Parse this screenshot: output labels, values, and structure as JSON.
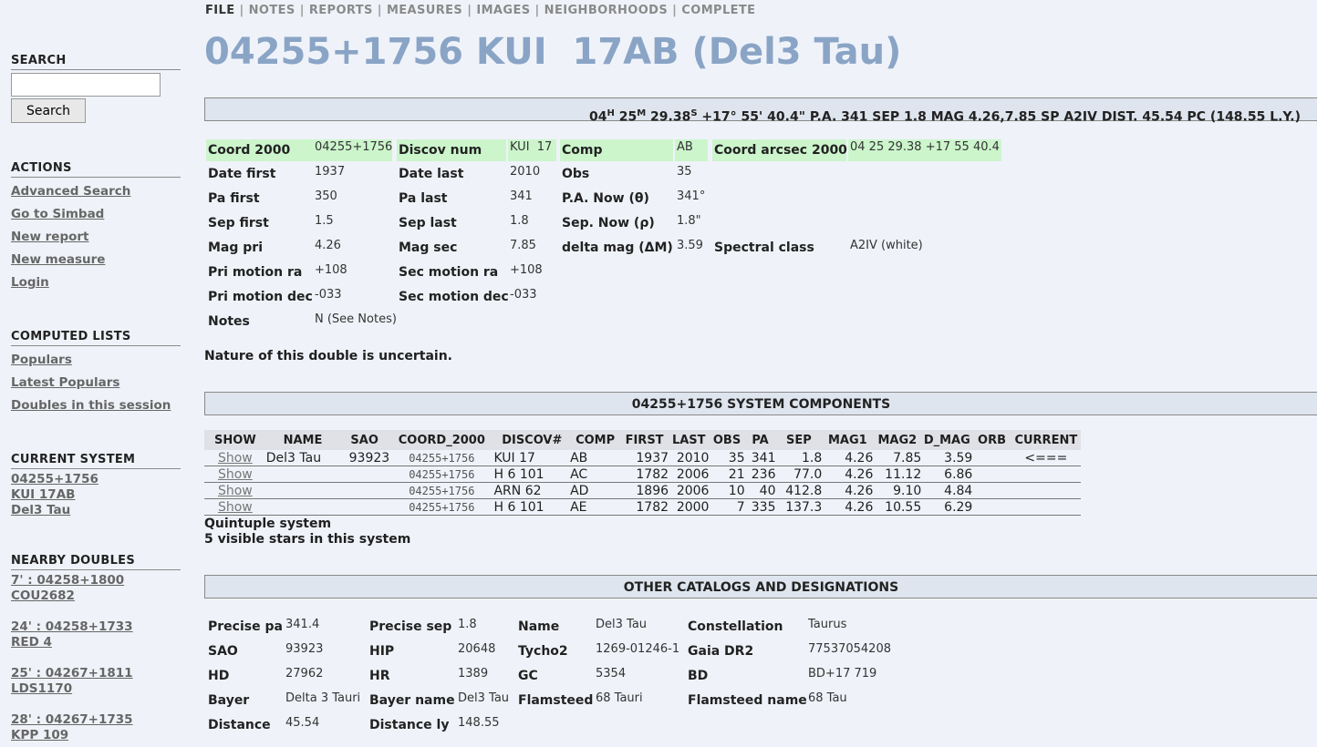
{
  "nav": {
    "items": [
      "FILE",
      "NOTES",
      "REPORTS",
      "MEASURES",
      "IMAGES",
      "NEIGHBORHOODS",
      "COMPLETE"
    ]
  },
  "title": "04255+1756 KUI  17AB (Del3 Tau)",
  "sidebar": {
    "search_heading": "SEARCH",
    "search_value": "",
    "search_button": "Search",
    "actions_heading": "ACTIONS",
    "actions": [
      "Advanced Search",
      "Go to Simbad",
      "New report",
      "New measure",
      "Login"
    ],
    "computed_heading": "COMPUTED LISTS",
    "computed": [
      "Populars",
      "Latest Populars",
      "Doubles in this session"
    ],
    "current_heading": "CURRENT SYSTEM",
    "current": [
      "04255+1756",
      "KUI 17AB",
      "Del3 Tau"
    ],
    "nearby_heading": "NEARBY DOUBLES",
    "nearby": [
      {
        "line1": "7' : 04258+1800",
        "line2": "COU2682"
      },
      {
        "line1": "24' : 04258+1733",
        "line2": "RED 4"
      },
      {
        "line1": "25' : 04267+1811",
        "line2": "LDS1170"
      },
      {
        "line1": "28' : 04267+1735",
        "line2": "KPP 109"
      }
    ]
  },
  "coord_bar": {
    "h": "04",
    "h_sup": "H",
    "m": "25",
    "m_sup": "M",
    "s": "29.38",
    "s_sup": "S",
    "rest": "+17° 55' 40.4\" P.A. 341 SEP 1.8 MAG 4.26,7.85 SP A2IV DIST. 45.54 PC (148.55 L.Y.)"
  },
  "details": {
    "coord2000_label": "Coord 2000",
    "coord2000": "04255+1756",
    "discov_label": "Discov num",
    "discov": "KUI  17",
    "comp_label": "Comp",
    "comp": "AB",
    "arcsec_label": "Coord arcsec 2000",
    "arcsec": "04 25 29.38 +17 55 40.4",
    "date_first_label": "Date first",
    "date_first": "1937",
    "date_last_label": "Date last",
    "date_last": "2010",
    "obs_label": "Obs",
    "obs": "35",
    "pa_first_label": "Pa first",
    "pa_first": "350",
    "pa_last_label": "Pa last",
    "pa_last": "341",
    "pa_now_label": "P.A. Now (θ)",
    "pa_now": "341°",
    "sep_first_label": "Sep first",
    "sep_first": "1.5",
    "sep_last_label": "Sep last",
    "sep_last": "1.8",
    "sep_now_label": "Sep. Now (ρ)",
    "sep_now": "1.8\"",
    "mag_pri_label": "Mag pri",
    "mag_pri": "4.26",
    "mag_sec_label": "Mag sec",
    "mag_sec": "7.85",
    "delta_mag_label": "delta mag (ΔM)",
    "delta_mag": "3.59",
    "spectral_label": "Spectral class",
    "spectral": "A2IV (white)",
    "pri_ra_label": "Pri motion ra",
    "pri_ra": "+108",
    "sec_ra_label": "Sec motion ra",
    "sec_ra": "+108",
    "pri_dec_label": "Pri motion dec",
    "pri_dec": "-033",
    "sec_dec_label": "Sec motion dec",
    "sec_dec": "-033",
    "notes_label": "Notes",
    "notes": "N (See Notes)"
  },
  "nature_text": "Nature of this double is uncertain.",
  "components": {
    "heading": "04255+1756 SYSTEM COMPONENTS",
    "columns": [
      "SHOW",
      "NAME",
      "SAO",
      "COORD_2000",
      "DISCOV#",
      "COMP",
      "FIRST",
      "LAST",
      "OBS",
      "PA",
      "SEP",
      "MAG1",
      "MAG2",
      "D_MAG",
      "ORB",
      "CURRENT"
    ],
    "rows": [
      [
        "Show",
        "Del3 Tau",
        "93923",
        "04255+1756",
        "KUI 17",
        "AB",
        "1937",
        "2010",
        "35",
        "341",
        "1.8",
        "4.26",
        "7.85",
        "3.59",
        "",
        "<==="
      ],
      [
        "Show",
        "",
        "",
        "04255+1756",
        "H 6 101",
        "AC",
        "1782",
        "2006",
        "21",
        "236",
        "77.0",
        "4.26",
        "11.12",
        "6.86",
        "",
        ""
      ],
      [
        "Show",
        "",
        "",
        "04255+1756",
        "ARN 62",
        "AD",
        "1896",
        "2006",
        "10",
        "40",
        "412.8",
        "4.26",
        "9.10",
        "4.84",
        "",
        ""
      ],
      [
        "Show",
        "",
        "",
        "04255+1756",
        "H 6 101",
        "AE",
        "1782",
        "2000",
        "7",
        "335",
        "137.3",
        "4.26",
        "10.55",
        "6.29",
        "",
        ""
      ]
    ],
    "summary1": "Quintuple system",
    "summary2": "5 visible stars in this system"
  },
  "catalogs": {
    "heading": "OTHER CATALOGS AND DESIGNATIONS",
    "precise_pa_label": "Precise pa",
    "precise_pa": "341.4",
    "precise_sep_label": "Precise sep",
    "precise_sep": "1.8",
    "name_label": "Name",
    "name": "Del3 Tau",
    "constellation_label": "Constellation",
    "constellation": "Taurus",
    "sao_label": "SAO",
    "sao": "93923",
    "hip_label": "HIP",
    "hip": "20648",
    "tycho_label": "Tycho2",
    "tycho": "1269-01246-1",
    "gaia_label": "Gaia DR2",
    "gaia": "77537054208",
    "hd_label": "HD",
    "hd": "27962",
    "hr_label": "HR",
    "hr": "1389",
    "gc_label": "GC",
    "gc": "5354",
    "bd_label": "BD",
    "bd": "BD+17 719",
    "bayer_label": "Bayer",
    "bayer": "Delta 3 Tauri",
    "bayer_name_label": "Bayer name",
    "bayer_name": "Del3 Tau",
    "flamsteed_label": "Flamsteed",
    "flamsteed": "68 Tauri",
    "flamsteed_name_label": "Flamsteed name",
    "flamsteed_name": "68 Tau",
    "distance_label": "Distance",
    "distance": "45.54",
    "distance_ly_label": "Distance ly",
    "distance_ly": "148.55"
  }
}
